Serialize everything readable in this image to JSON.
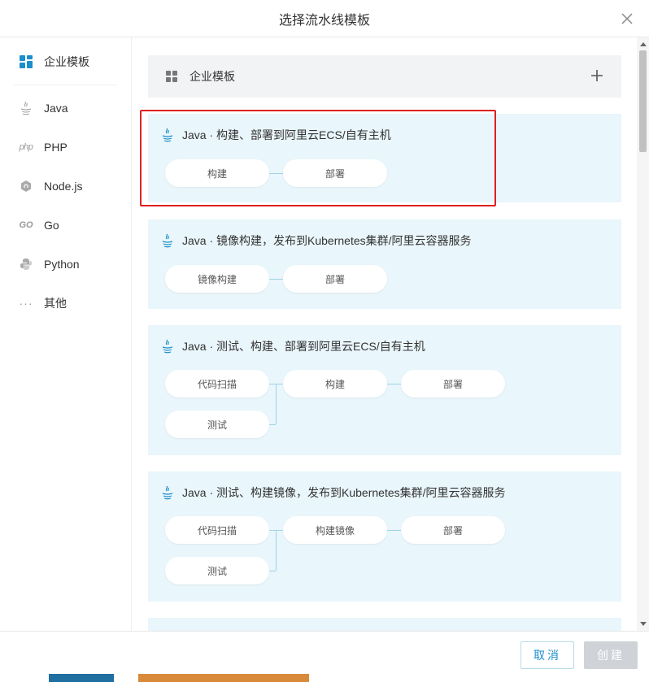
{
  "modal": {
    "title": "选择流水线模板"
  },
  "sidebar": {
    "items": [
      {
        "label": "企业模板",
        "icon": "grid-icon",
        "active": true
      },
      {
        "label": "Java",
        "icon": "java-icon"
      },
      {
        "label": "PHP",
        "icon": "php-icon",
        "icon_text": "php"
      },
      {
        "label": "Node.js",
        "icon": "nodejs-icon"
      },
      {
        "label": "Go",
        "icon": "go-icon",
        "icon_text": "GO"
      },
      {
        "label": "Python",
        "icon": "python-icon"
      },
      {
        "label": "其他",
        "icon": "more-icon",
        "icon_text": "···"
      }
    ]
  },
  "group": {
    "title": "企业模板",
    "add_icon": "plus-icon"
  },
  "templates": [
    {
      "title": "Java · 构建、部署到阿里云ECS/自有主机",
      "stages": [
        "构建",
        "部署"
      ],
      "selected": true
    },
    {
      "title": "Java · 镜像构建，发布到Kubernetes集群/阿里云容器服务",
      "stages": [
        "镜像构建",
        "部署"
      ]
    },
    {
      "title": "Java · 测试、构建、部署到阿里云ECS/自有主机",
      "stages": [
        "代码扫描",
        "测试",
        "构建",
        "部署"
      ]
    },
    {
      "title": "Java · 测试、构建镜像，发布到Kubernetes集群/阿里云容器服务",
      "stages": [
        "代码扫描",
        "测试",
        "构建镜像",
        "部署"
      ]
    }
  ],
  "footer": {
    "cancel_label": "取消",
    "create_label": "创建"
  },
  "colors": {
    "accent": "#1b8ecb",
    "card_bg": "#e9f6fb",
    "selection": "#e02020",
    "disabled": "#cfd3d8"
  }
}
